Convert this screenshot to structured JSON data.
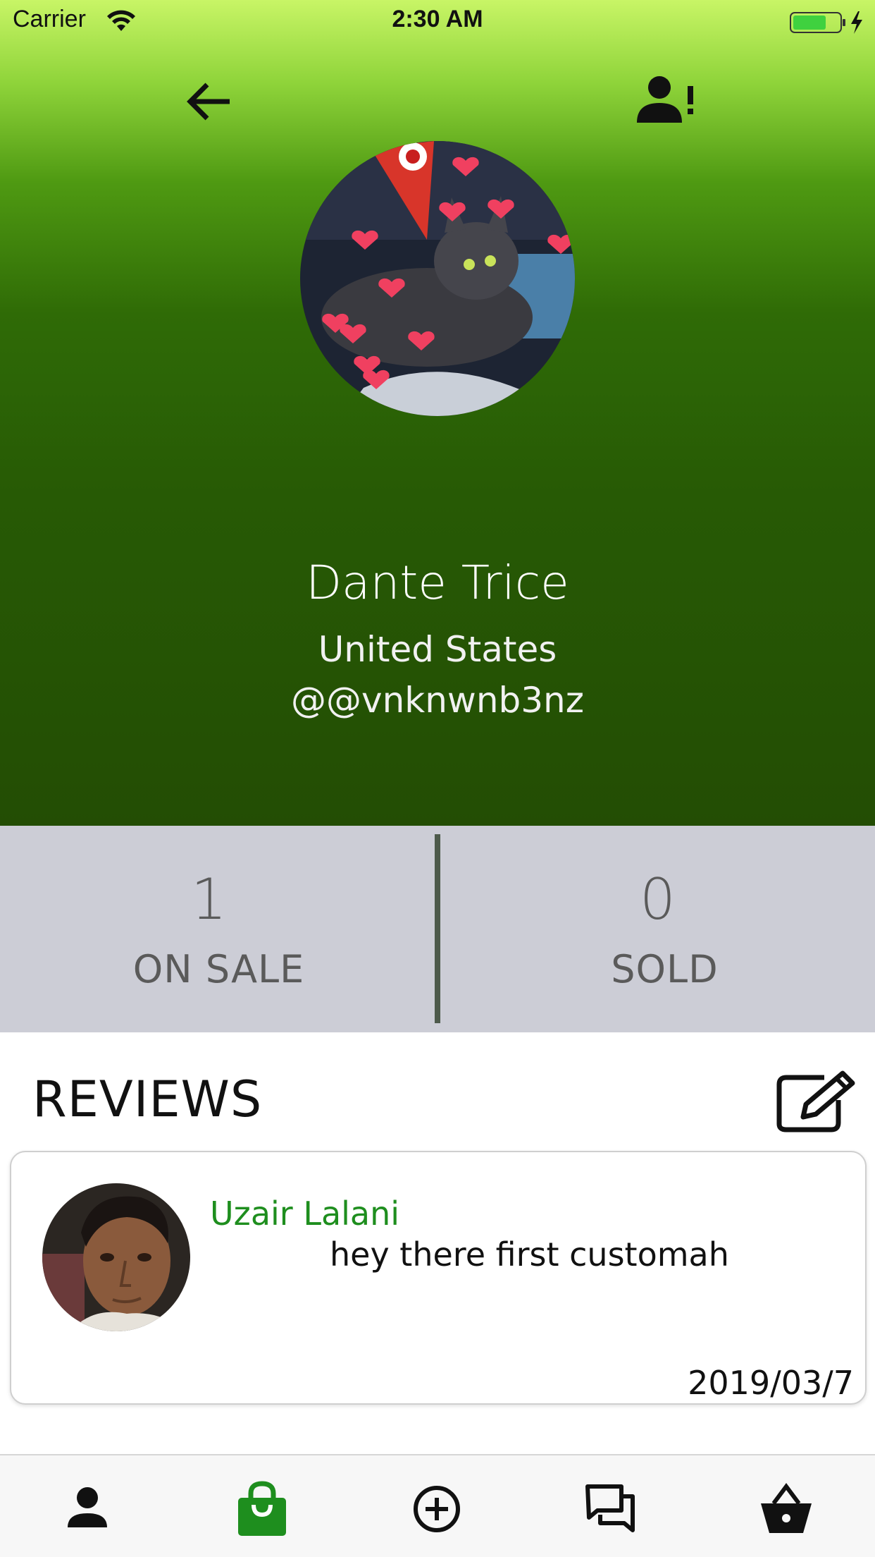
{
  "status_bar": {
    "carrier": "Carrier",
    "time": "2:30 AM"
  },
  "header": {
    "back_icon": "arrow-left-icon",
    "report_icon": "report-user-icon"
  },
  "profile": {
    "name": "Dante Trice",
    "country": "United States",
    "handle": "@@vnknwnb3nz"
  },
  "stats": {
    "on_sale_value": "1",
    "on_sale_label": "ON SALE",
    "sold_value": "0",
    "sold_label": "SOLD"
  },
  "reviews": {
    "title": "REVIEWS",
    "write_icon": "edit-icon",
    "items": [
      {
        "reviewer": "Uzair Lalani",
        "text": "hey there first customah",
        "date": "2019/03/7"
      }
    ]
  },
  "tab_bar": {
    "items": [
      {
        "icon": "person-icon",
        "active": false
      },
      {
        "icon": "shopping-bag-icon",
        "active": true
      },
      {
        "icon": "add-circle-icon",
        "active": false
      },
      {
        "icon": "chat-icon",
        "active": false
      },
      {
        "icon": "basket-icon",
        "active": false
      }
    ],
    "active_color": "#1e8e1e"
  },
  "colors": {
    "accent": "#1e8e1e",
    "stats_bg": "#cccdd6"
  }
}
